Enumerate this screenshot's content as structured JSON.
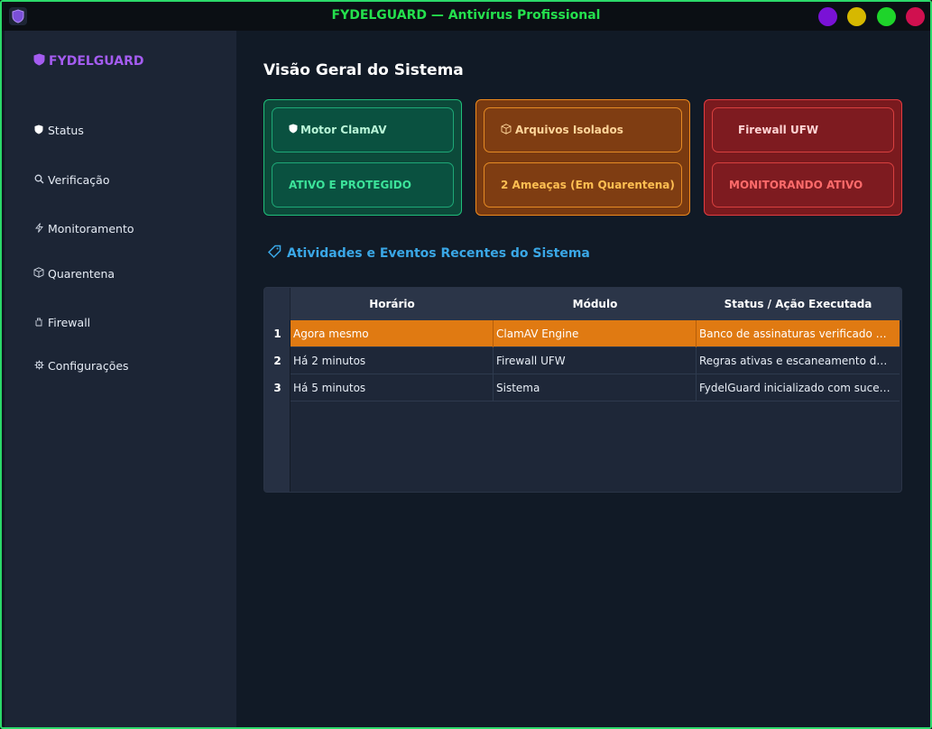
{
  "window": {
    "title": "FYDELGUARD — Antivírus Profissional"
  },
  "sidebar": {
    "brand": "FYDELGUARD",
    "items": [
      {
        "icon": "⛊",
        "label": "Status"
      },
      {
        "icon": "🔍",
        "label": "Verificação"
      },
      {
        "icon": "⚡",
        "label": "Monitoramento"
      },
      {
        "icon": "📦",
        "label": "Quarentena"
      },
      {
        "icon": "🖐",
        "label": "Firewall"
      },
      {
        "icon": "⚙",
        "label": "Configurações"
      }
    ]
  },
  "main": {
    "title": "Visão Geral do Sistema",
    "cards": [
      {
        "label": "Motor ClamAV",
        "status": "ATIVO E PROTEGIDO"
      },
      {
        "label": "Arquivos Isolados",
        "status": "2 Ameaças (Em Quarentena)"
      },
      {
        "label": "Firewall UFW",
        "status": "MONITORANDO ATIVO"
      }
    ],
    "section_title": "Atividades e Eventos Recentes do Sistema",
    "table": {
      "headers": [
        "Horário",
        "Módulo",
        "Status / Ação Executada"
      ],
      "rows": [
        {
          "num": "1",
          "cells": [
            "Agora mesmo",
            "ClamAV Engine",
            "Banco de assinaturas verificado com sucesso"
          ]
        },
        {
          "num": "2",
          "cells": [
            "Há 2 minutos",
            "Firewall UFW",
            "Regras ativas e escaneamento de portas concluído"
          ]
        },
        {
          "num": "3",
          "cells": [
            "Há 5 minutos",
            "Sistema",
            "FydelGuard inicializado com sucesso"
          ]
        }
      ]
    }
  },
  "colors": {
    "title_green": "#24e04d",
    "brand_purple": "#a45cf0",
    "section_blue": "#3aa7e6",
    "selected_row": "#e07a12"
  }
}
